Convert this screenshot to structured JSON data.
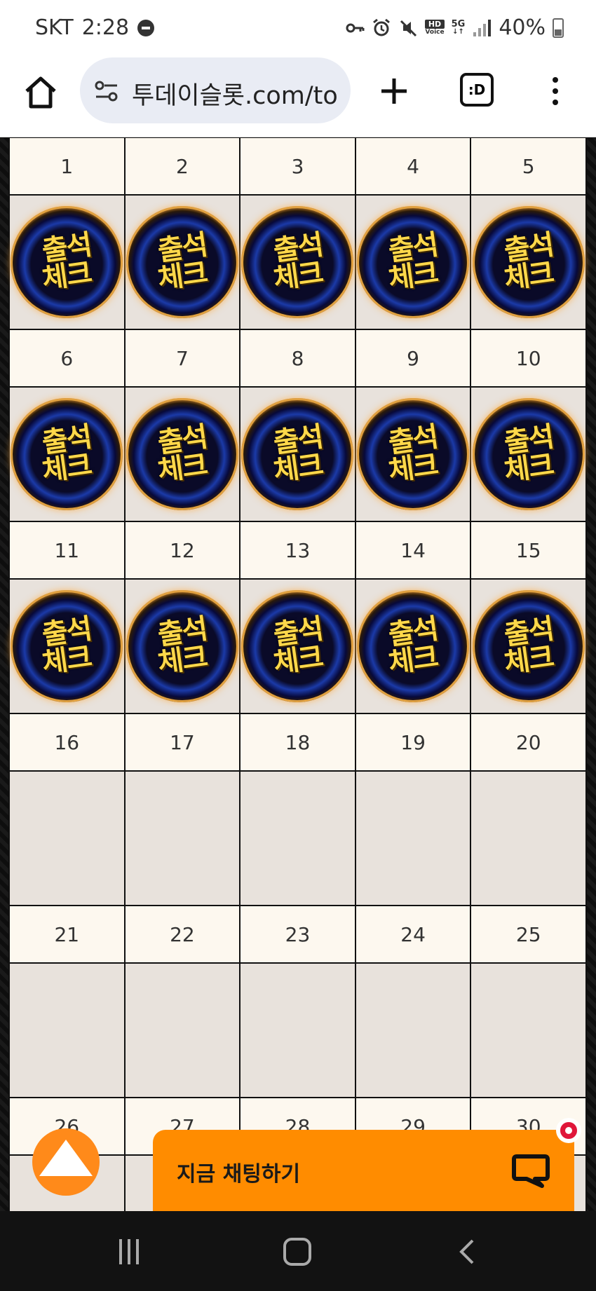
{
  "status_bar": {
    "carrier": "SKT",
    "time": "2:28",
    "battery": "40%",
    "hd_voice_top": "HD",
    "hd_voice_bottom": "Voice",
    "network": "5G"
  },
  "browser": {
    "url": "투데이슬롯.com/to",
    "tab_badge": ":D"
  },
  "calendar": {
    "stamp_line1": "출석",
    "stamp_line2": "체크",
    "weeks": [
      {
        "days": [
          "1",
          "2",
          "3",
          "4",
          "5"
        ],
        "stamped": [
          true,
          true,
          true,
          true,
          true
        ]
      },
      {
        "days": [
          "6",
          "7",
          "8",
          "9",
          "10"
        ],
        "stamped": [
          true,
          true,
          true,
          true,
          true
        ]
      },
      {
        "days": [
          "11",
          "12",
          "13",
          "14",
          "15"
        ],
        "stamped": [
          true,
          true,
          true,
          true,
          true
        ]
      },
      {
        "days": [
          "16",
          "17",
          "18",
          "19",
          "20"
        ],
        "stamped": [
          false,
          false,
          false,
          false,
          false
        ]
      },
      {
        "days": [
          "21",
          "22",
          "23",
          "24",
          "25"
        ],
        "stamped": [
          false,
          false,
          false,
          false,
          false
        ]
      },
      {
        "days": [
          "26",
          "27",
          "28",
          "29",
          "30"
        ],
        "stamped": [
          false,
          false,
          false,
          false,
          false
        ]
      }
    ]
  },
  "chat": {
    "label": "지금 채팅하기"
  },
  "colors": {
    "accent": "#ff8c00",
    "cell_num_bg": "#fdf8ef",
    "cell_stamp_bg": "#e8e2dc"
  }
}
